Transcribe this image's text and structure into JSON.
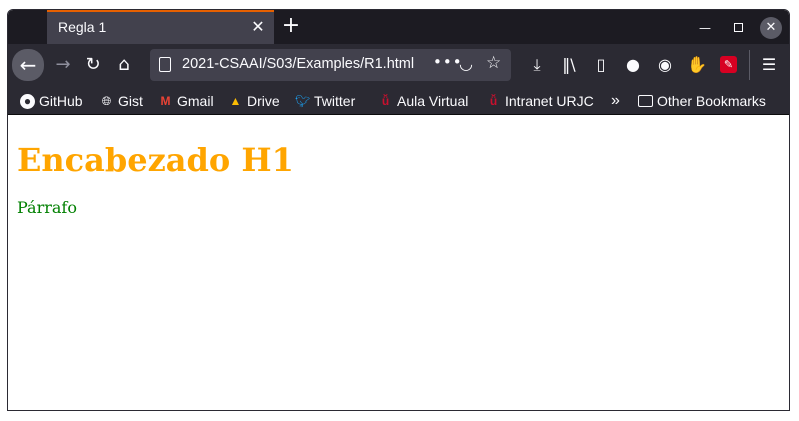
{
  "tab": {
    "title": "Regla 1",
    "close_icon": "close-icon",
    "new_tab_icon": "plus-icon"
  },
  "window_controls": {
    "minimize": "minimize-icon",
    "maximize": "maximize-icon",
    "close": "close-icon"
  },
  "navbar": {
    "back_icon": "arrow-left-icon",
    "forward_icon": "arrow-right-icon",
    "reload_icon": "reload-icon",
    "home_icon": "home-icon",
    "url": "2021-CSAAI/S03/Examples/R1.html",
    "page_actions": [
      "more-icon",
      "pocket-icon",
      "bookmark-star-icon"
    ],
    "toolbar_icons": [
      "download-icon",
      "library-icon",
      "sidebar-icon",
      "account-icon",
      "github-icon",
      "gnome-icon",
      "extension-icon",
      "menu-icon"
    ]
  },
  "bookmarks": {
    "items": [
      {
        "label": "GitHub",
        "icon": "github-icon"
      },
      {
        "label": "Gist",
        "icon": "globe-icon"
      },
      {
        "label": "Gmail",
        "icon": "gmail-icon"
      },
      {
        "label": "Drive",
        "icon": "drive-icon"
      },
      {
        "label": "Twitter",
        "icon": "twitter-icon"
      },
      {
        "label": "Aula Virtual",
        "icon": "urjc-icon"
      },
      {
        "label": "Intranet URJC",
        "icon": "urjc-icon"
      }
    ],
    "overflow_icon": "chevron-double-right-icon",
    "other": {
      "label": "Other Bookmarks",
      "icon": "folder-icon"
    }
  },
  "page": {
    "heading": "Encabezado H1",
    "paragraph": "Párrafo",
    "heading_color": "#ffa500",
    "paragraph_color": "#008000"
  },
  "colors": {
    "accent": "#e66000",
    "chrome_dark": "#1c1b22",
    "toolbar": "#2b2a33",
    "tab_active": "#42414d"
  }
}
